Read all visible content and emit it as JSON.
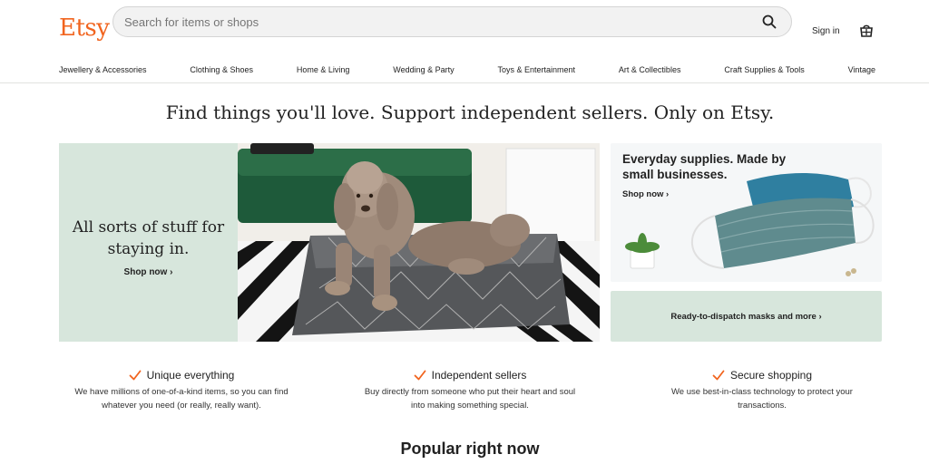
{
  "header": {
    "logo": "Etsy",
    "search_placeholder": "Search for items or shops",
    "sign_in": "Sign in"
  },
  "nav": [
    "Jewellery & Accessories",
    "Clothing & Shoes",
    "Home & Living",
    "Wedding & Party",
    "Toys & Entertainment",
    "Art & Collectibles",
    "Craft Supplies & Tools",
    "Vintage"
  ],
  "headline": "Find things you'll love. Support independent sellers. Only on Etsy.",
  "hero": {
    "title": "All sorts of stuff for staying in.",
    "link": "Shop now ›"
  },
  "side_card": {
    "title": "Everyday supplies. Made by small businesses.",
    "link": "Shop now ›"
  },
  "masks_link": "Ready-to-dispatch masks and more ›",
  "features": [
    {
      "title": "Unique everything",
      "desc": "We have millions of one-of-a-kind items, so you can find whatever you need (or really, really want)."
    },
    {
      "title": "Independent sellers",
      "desc": "Buy directly from someone who put their heart and soul into making something special."
    },
    {
      "title": "Secure shopping",
      "desc": "We use best-in-class technology to protect your transactions."
    }
  ],
  "popular": "Popular right now",
  "colors": {
    "brand": "#f1641e",
    "mint": "#d7e6dc"
  },
  "icons": [
    "search-icon",
    "cart-icon",
    "check-icon"
  ]
}
